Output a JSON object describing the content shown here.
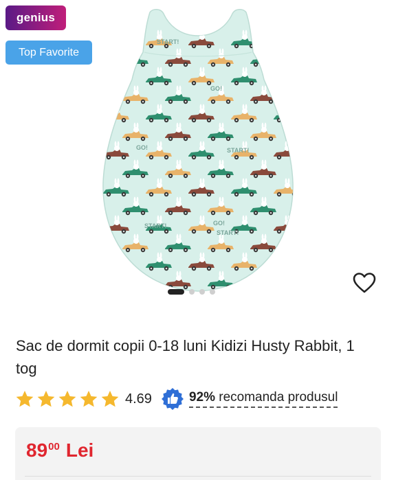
{
  "badges": {
    "genius": "genius",
    "top_favorite": "Top Favorite"
  },
  "product": {
    "title": "Sac de dormit copii 0-18 luni Kidizi Husty Rabbit, 1 tog",
    "rating": "4.69",
    "stars": 5,
    "recommend_percent": "92%",
    "recommend_text": "recomanda produsul",
    "price_integer": "89",
    "price_decimals": "00",
    "price_currency": "Lei"
  },
  "image": {
    "print_text": [
      "START!",
      "GO!",
      "START!",
      "GO!",
      "GO!",
      "START!",
      "START!"
    ]
  },
  "carousel": {
    "total": 4,
    "active": 1
  },
  "colors": {
    "price": "#e0262f",
    "star": "#f5b82e",
    "thumb": "#2f6fd6",
    "genius_start": "#5a1a86",
    "genius_end": "#c01e7a",
    "top_favorite_bg": "#4aa3e8",
    "sack_fabric": "#d8f0ea"
  },
  "icons": {
    "favorite": "heart-outline-icon",
    "rating": "star-icon",
    "recommend": "thumbs-up-icon"
  }
}
